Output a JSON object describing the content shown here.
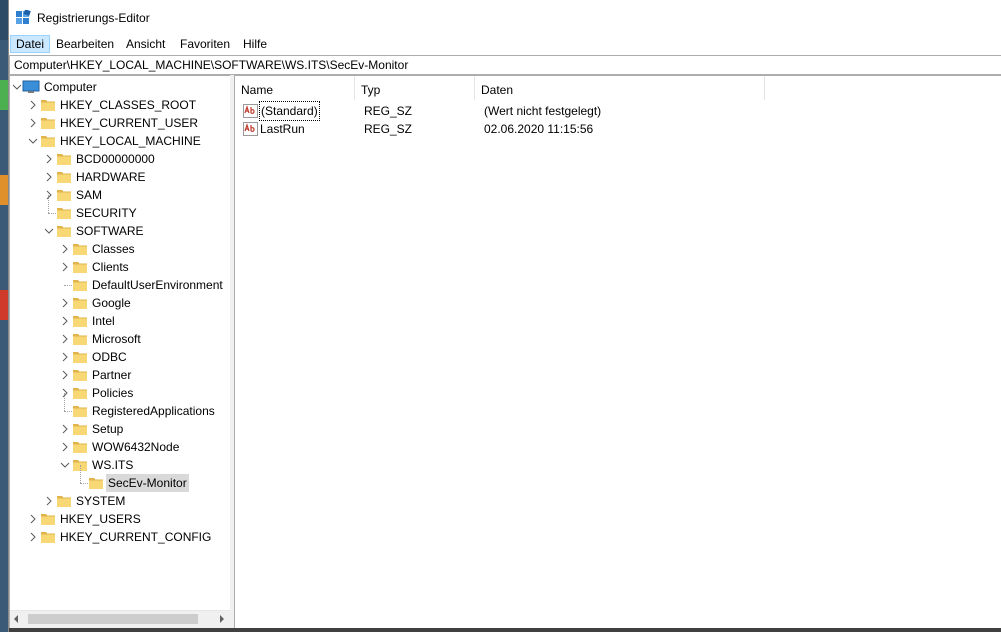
{
  "window": {
    "title": "Registrierungs-Editor"
  },
  "menu": {
    "items": [
      "Datei",
      "Bearbeiten",
      "Ansicht",
      "Favoriten",
      "Hilfe"
    ],
    "active_index": 0
  },
  "address": {
    "path": "Computer\\HKEY_LOCAL_MACHINE\\SOFTWARE\\WS.ITS\\SecEv-Monitor"
  },
  "tree": {
    "root_label": "Computer",
    "nodes": [
      {
        "label": "HKEY_CLASSES_ROOT",
        "depth": 1,
        "expander": "collapsed"
      },
      {
        "label": "HKEY_CURRENT_USER",
        "depth": 1,
        "expander": "collapsed"
      },
      {
        "label": "HKEY_LOCAL_MACHINE",
        "depth": 1,
        "expander": "expanded"
      },
      {
        "label": "BCD00000000",
        "depth": 2,
        "expander": "collapsed"
      },
      {
        "label": "HARDWARE",
        "depth": 2,
        "expander": "collapsed"
      },
      {
        "label": "SAM",
        "depth": 2,
        "expander": "collapsed"
      },
      {
        "label": "SECURITY",
        "depth": 2,
        "expander": "none"
      },
      {
        "label": "SOFTWARE",
        "depth": 2,
        "expander": "expanded"
      },
      {
        "label": "Classes",
        "depth": 3,
        "expander": "collapsed"
      },
      {
        "label": "Clients",
        "depth": 3,
        "expander": "collapsed"
      },
      {
        "label": "DefaultUserEnvironment",
        "depth": 3,
        "expander": "none"
      },
      {
        "label": "Google",
        "depth": 3,
        "expander": "collapsed"
      },
      {
        "label": "Intel",
        "depth": 3,
        "expander": "collapsed"
      },
      {
        "label": "Microsoft",
        "depth": 3,
        "expander": "collapsed"
      },
      {
        "label": "ODBC",
        "depth": 3,
        "expander": "collapsed"
      },
      {
        "label": "Partner",
        "depth": 3,
        "expander": "collapsed"
      },
      {
        "label": "Policies",
        "depth": 3,
        "expander": "collapsed"
      },
      {
        "label": "RegisteredApplications",
        "depth": 3,
        "expander": "none"
      },
      {
        "label": "Setup",
        "depth": 3,
        "expander": "collapsed"
      },
      {
        "label": "WOW6432Node",
        "depth": 3,
        "expander": "collapsed"
      },
      {
        "label": "WS.ITS",
        "depth": 3,
        "expander": "expanded"
      },
      {
        "label": "SecEv-Monitor",
        "depth": 4,
        "expander": "none",
        "selected": true
      },
      {
        "label": "SYSTEM",
        "depth": 2,
        "expander": "collapsed"
      },
      {
        "label": "HKEY_USERS",
        "depth": 1,
        "expander": "collapsed"
      },
      {
        "label": "HKEY_CURRENT_CONFIG",
        "depth": 1,
        "expander": "collapsed"
      }
    ]
  },
  "values": {
    "columns": [
      "Name",
      "Typ",
      "Daten"
    ],
    "rows": [
      {
        "name": "(Standard)",
        "type": "REG_SZ",
        "data": "(Wert nicht festgelegt)",
        "focused": true
      },
      {
        "name": "LastRun",
        "type": "REG_SZ",
        "data": "02.06.2020 11:15:56",
        "focused": false
      }
    ]
  },
  "colors": {
    "folder": "#f8d775",
    "folder_dark": "#e0b44a",
    "selection": "#d9d9d9",
    "menu_active": "#cce8ff",
    "reg_icon_red": "#c0392b"
  },
  "icons": {
    "app": "registry-editor-icon",
    "computer": "computer-icon",
    "folder": "folder-icon",
    "value": "string-value-icon"
  }
}
